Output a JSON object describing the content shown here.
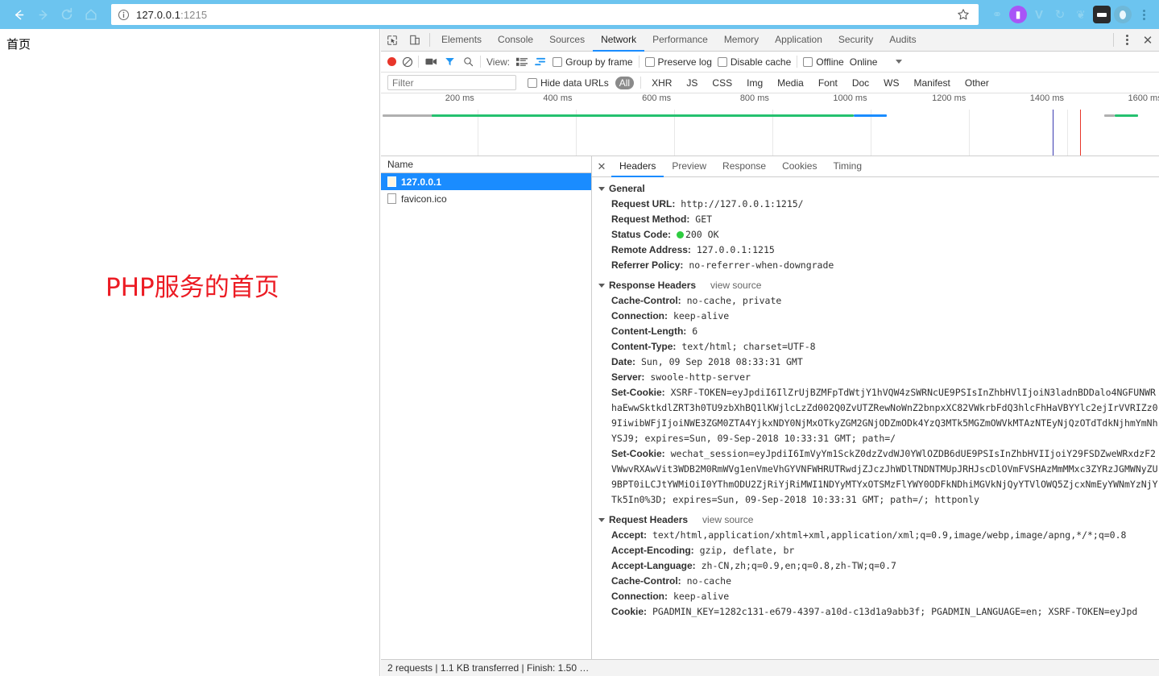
{
  "browser": {
    "back_icon": "back-arrow-icon",
    "forward_icon": "forward-arrow-icon",
    "reload_icon": "reload-icon",
    "home_icon": "home-icon",
    "url_text": "127.0.0.1",
    "url_port": ":1215",
    "url_full": "127.0.0.1:1215",
    "info_icon": "info-circle-icon",
    "bookmark_icon": "star-icon",
    "menu_icon": "three-dot-menu-icon",
    "extensions": [
      {
        "name": "shield-extension-icon",
        "glyph": "⛉",
        "color": "#8fd3f0"
      },
      {
        "name": "purple-badge-extension-icon",
        "glyph": "▮",
        "color": "#a855f7"
      },
      {
        "name": "v-extension-icon",
        "glyph": "V",
        "color": "#8fd3f0"
      },
      {
        "name": "refresh-extension-icon",
        "glyph": "↻",
        "color": "#8fd3f0"
      },
      {
        "name": "leaf-extension-icon",
        "glyph": "❦",
        "color": "#8fd3f0"
      },
      {
        "name": "bandit-extension-icon",
        "glyph": "▬",
        "color": "#2b2b2b"
      },
      {
        "name": "circle-extension-icon",
        "glyph": "●",
        "color": "#6fb8d8"
      }
    ]
  },
  "page": {
    "heading": "首页",
    "body_text": "PHP服务的首页",
    "body_text_color": "#ec1c24"
  },
  "devtools": {
    "inspect_icon": "inspect-element-icon",
    "device_icon": "toggle-device-toolbar-icon",
    "tabs": [
      {
        "label": "Elements",
        "active": false
      },
      {
        "label": "Console",
        "active": false
      },
      {
        "label": "Sources",
        "active": false
      },
      {
        "label": "Network",
        "active": true
      },
      {
        "label": "Performance",
        "active": false
      },
      {
        "label": "Memory",
        "active": false
      },
      {
        "label": "Application",
        "active": false
      },
      {
        "label": "Security",
        "active": false
      },
      {
        "label": "Audits",
        "active": false
      }
    ],
    "more_icon": "more-options-icon",
    "close_icon": "close-devtools-icon",
    "network_toolbar": {
      "record_label": "record-button",
      "clear_label": "clear-button",
      "camera_label": "capture-screenshots-button",
      "filter_label": "filter-button",
      "search_label": "search-button",
      "view_label": "View:",
      "view_large_rows": "large-request-rows-button",
      "view_overview": "show-overview-button",
      "group_by_frame": "Group by frame",
      "preserve_log": "Preserve log",
      "disable_cache": "Disable cache",
      "offline": "Offline",
      "throttle_value": "Online"
    },
    "filter_bar": {
      "filter_placeholder": "Filter",
      "filter_value": "",
      "hide_data_urls": "Hide data URLs",
      "types": [
        {
          "label": "All",
          "active": true
        },
        {
          "label": "XHR",
          "active": false
        },
        {
          "label": "JS",
          "active": false
        },
        {
          "label": "CSS",
          "active": false
        },
        {
          "label": "Img",
          "active": false
        },
        {
          "label": "Media",
          "active": false
        },
        {
          "label": "Font",
          "active": false
        },
        {
          "label": "Doc",
          "active": false
        },
        {
          "label": "WS",
          "active": false
        },
        {
          "label": "Manifest",
          "active": false
        },
        {
          "label": "Other",
          "active": false
        }
      ]
    },
    "overview": {
      "ticks": [
        "200 ms",
        "400 ms",
        "600 ms",
        "800 ms",
        "1000 ms",
        "1200 ms",
        "1400 ms",
        "1600 ms"
      ],
      "bars": [
        {
          "left_pct": 0.2,
          "width_pct": 6.5,
          "color": "#b0b0b0"
        },
        {
          "left_pct": 6.5,
          "width_pct": 54.3,
          "color": "#25c16f"
        },
        {
          "left_pct": 60.8,
          "width_pct": 4.2,
          "color": "#1a8cff"
        },
        {
          "left_pct": 93.0,
          "width_pct": 1.3,
          "color": "#b0b0b0"
        },
        {
          "left_pct": 94.3,
          "width_pct": 3.0,
          "color": "#25c16f"
        }
      ],
      "markers": [
        {
          "left_pct": 86.3,
          "color": "#3a3ab0"
        },
        {
          "left_pct": 89.9,
          "color": "#e8362a"
        }
      ]
    },
    "requests": {
      "column_header": "Name",
      "rows": [
        {
          "name": "127.0.0.1",
          "selected": true
        },
        {
          "name": "favicon.ico",
          "selected": false
        }
      ]
    },
    "detail": {
      "close_icon": "close-detail-icon",
      "tabs": [
        {
          "label": "Headers",
          "active": true
        },
        {
          "label": "Preview",
          "active": false
        },
        {
          "label": "Response",
          "active": false
        },
        {
          "label": "Cookies",
          "active": false
        },
        {
          "label": "Timing",
          "active": false
        }
      ],
      "general": {
        "title": "General",
        "rows": [
          {
            "name": "Request URL:",
            "value": "http://127.0.0.1:1215/"
          },
          {
            "name": "Request Method:",
            "value": "GET"
          },
          {
            "name": "Status Code:",
            "value": "200 OK",
            "has_status_dot": true
          },
          {
            "name": "Remote Address:",
            "value": "127.0.0.1:1215"
          },
          {
            "name": "Referrer Policy:",
            "value": "no-referrer-when-downgrade"
          }
        ]
      },
      "response_headers": {
        "title": "Response Headers",
        "view_source": "view source",
        "rows": [
          {
            "name": "Cache-Control:",
            "value": "no-cache, private"
          },
          {
            "name": "Connection:",
            "value": "keep-alive"
          },
          {
            "name": "Content-Length:",
            "value": "6"
          },
          {
            "name": "Content-Type:",
            "value": "text/html; charset=UTF-8"
          },
          {
            "name": "Date:",
            "value": "Sun, 09 Sep 2018 08:33:31 GMT"
          },
          {
            "name": "Server:",
            "value": "swoole-http-server"
          },
          {
            "name": "Set-Cookie:",
            "value": "XSRF-TOKEN=eyJpdiI6IlZrUjBZMFpTdWtjY1hVQW4zSWRNcUE9PSIsInZhbHVlIjoiN3ladnBDDalo4NGFUNWRhaEwwSktkdlZRT3h0TU9zbXhBQ1lKWjlcLzZd002Q0ZvUTZRewNoWnZ2bnpxXC82VWkrbFdQ3hlcFhHaVBYYlc2ejIrVVRIZz09IiwibWFjIjoiNWE3ZGM0ZTA4YjkxNDY0NjMxOTkyZGM2GNjODZmODk4YzQ3MTk5MGZmOWVkMTAzNTEyNjQzOTdTdkNjhmYmNhYSJ9; expires=Sun, 09-Sep-2018 10:33:31 GMT; path=/"
          },
          {
            "name": "Set-Cookie:",
            "value": "wechat_session=eyJpdiI6ImVyYm1SckZ0dzZvdWJ0YWlOZDB6dUE9PSIsInZhbHVIIjoiY29FSDZweWRxdzF2VWwvRXAwVit3WDB2M0RmWVg1enVmeVhGYVNFWHRUTRwdjZJczJhWDlTNDNTMUpJRHJscDlOVmFVSHAzMmMMxc3ZYRzJGMWNyZU9BPT0iLCJtYWMiOiI0YThmODU2ZjRiYjRiMWI1NDYyMTYxOTSMzFlYWY0ODFkNDhiMGVkNjQyYTVlOWQ5ZjcxNmEyYWNmYzNjYTk5In0%3D; expires=Sun, 09-Sep-2018 10:33:31 GMT; path=/; httponly"
          }
        ]
      },
      "request_headers": {
        "title": "Request Headers",
        "view_source": "view source",
        "rows": [
          {
            "name": "Accept:",
            "value": "text/html,application/xhtml+xml,application/xml;q=0.9,image/webp,image/apng,*/*;q=0.8"
          },
          {
            "name": "Accept-Encoding:",
            "value": "gzip, deflate, br"
          },
          {
            "name": "Accept-Language:",
            "value": "zh-CN,zh;q=0.9,en;q=0.8,zh-TW;q=0.7"
          },
          {
            "name": "Cache-Control:",
            "value": "no-cache"
          },
          {
            "name": "Connection:",
            "value": "keep-alive"
          },
          {
            "name": "Cookie:",
            "value": "PGADMIN_KEY=1282c131-e679-4397-a10d-c13d1a9abb3f; PGADMIN_LANGUAGE=en; XSRF-TOKEN=eyJpd"
          }
        ]
      }
    },
    "statusbar": {
      "text": "2 requests | 1.1 KB transferred | Finish: 1.50 …"
    }
  }
}
